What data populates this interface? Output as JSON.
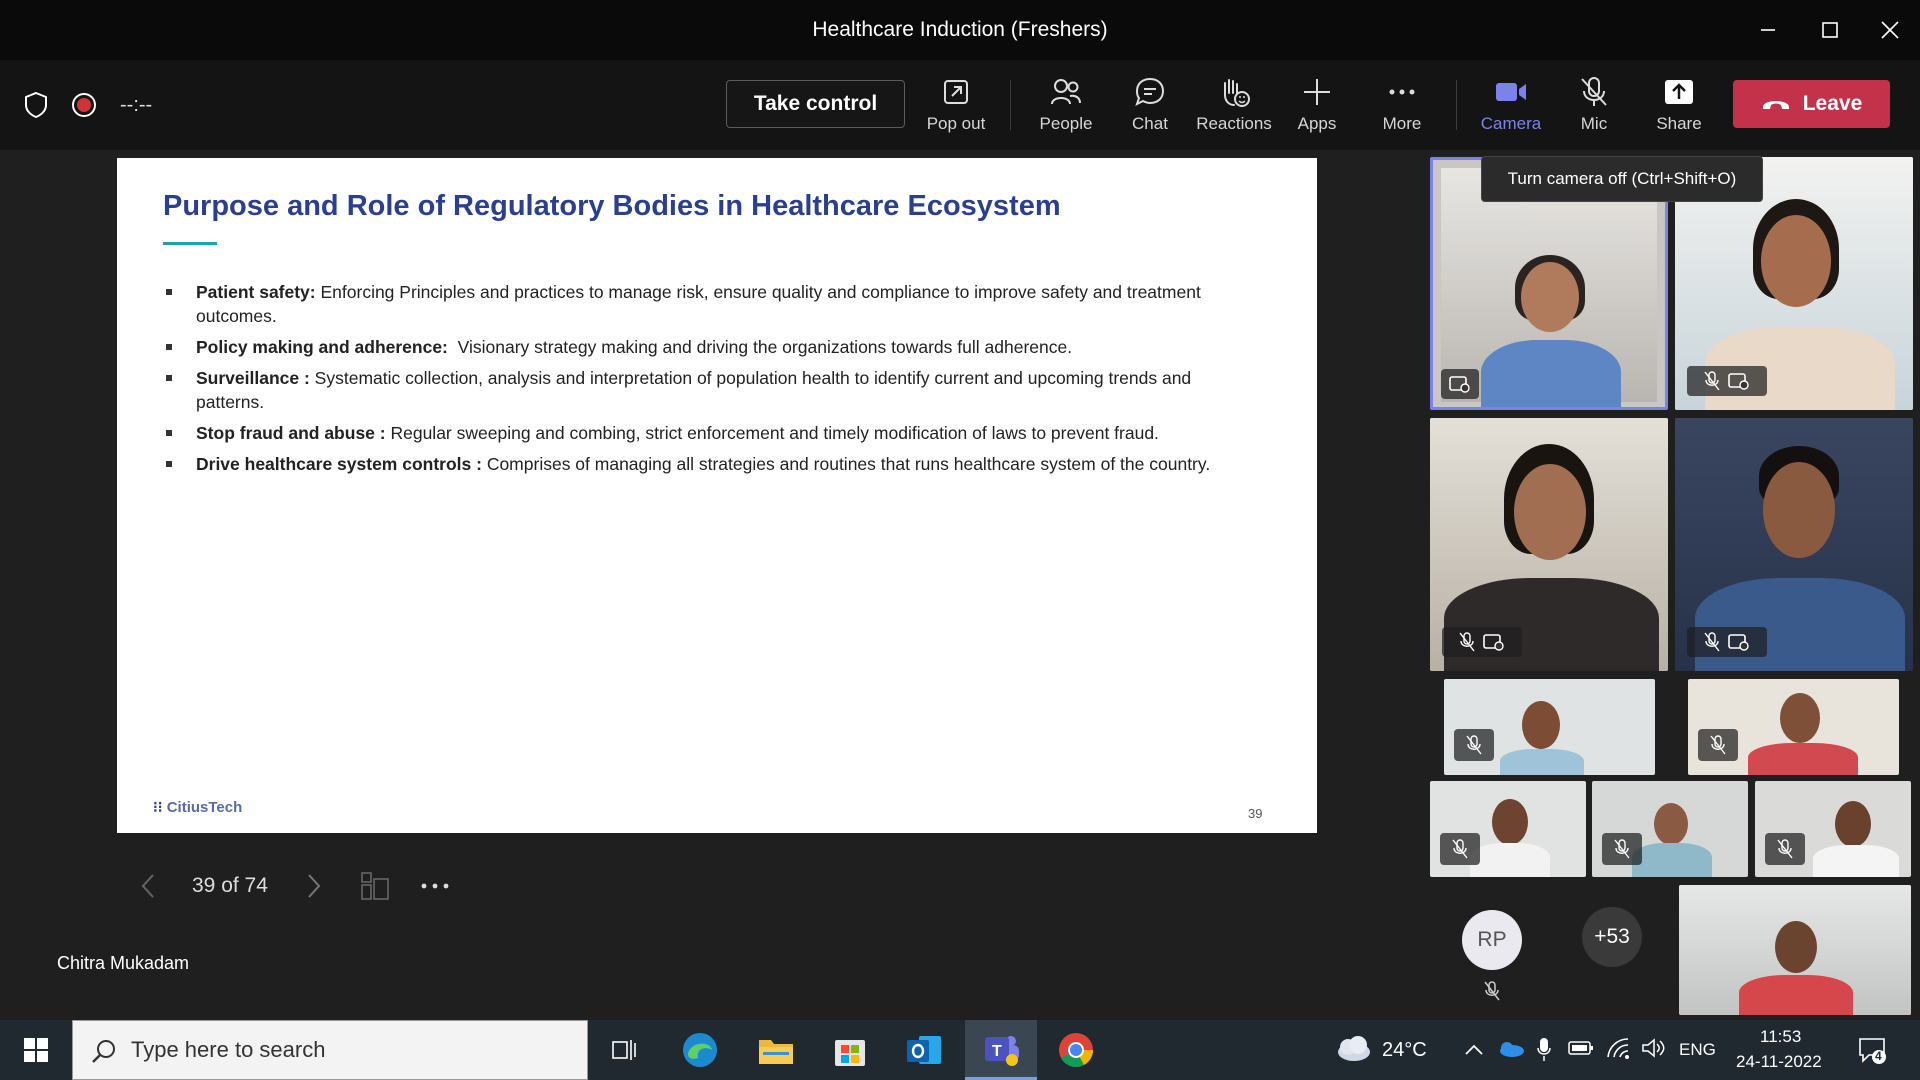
{
  "window": {
    "title": "Healthcare Induction (Freshers)"
  },
  "toolbar": {
    "timer": "--:--",
    "take_control": "Take control",
    "pop_out": "Pop out",
    "people": "People",
    "chat": "Chat",
    "reactions": "Reactions",
    "apps": "Apps",
    "more": "More",
    "camera": "Camera",
    "mic": "Mic",
    "share": "Share",
    "leave": "Leave",
    "camera_accent": "#7b83eb",
    "leave_color": "#c4314b"
  },
  "tooltip": "Turn camera off (Ctrl+Shift+O)",
  "slide": {
    "title": "Purpose and Role of Regulatory Bodies in Healthcare Ecosystem",
    "bullets": [
      {
        "term": "Patient safety:",
        "text": " Enforcing Principles and practices to manage risk, ensure quality and compliance to improve safety and treatment outcomes."
      },
      {
        "term": "Policy making and adherence:",
        "text": "  Visionary strategy making and driving the organizations towards full adherence."
      },
      {
        "term": "Surveillance :",
        "text": " Systematic collection, analysis and interpretation of population health to identify current and upcoming trends and patterns."
      },
      {
        "term": "Stop fraud and abuse :",
        "text": " Regular sweeping and combing, strict enforcement and timely modification of laws to prevent fraud."
      },
      {
        "term": "Drive healthcare system controls :",
        "text": " Comprises of managing all strategies and routines that runs healthcare system of the country."
      }
    ],
    "logo": "CitiusTech",
    "page_number": "39"
  },
  "slide_nav": {
    "counter": "39 of 74"
  },
  "presenter_name": "Chitra Mukadam",
  "gallery": {
    "avatar_initials": "RP",
    "overflow_count": "+53"
  },
  "taskbar": {
    "search_placeholder": "Type here to search",
    "weather": "24°C",
    "language": "ENG",
    "time": "11:53",
    "date": "24-11-2022",
    "notifications": "4"
  }
}
